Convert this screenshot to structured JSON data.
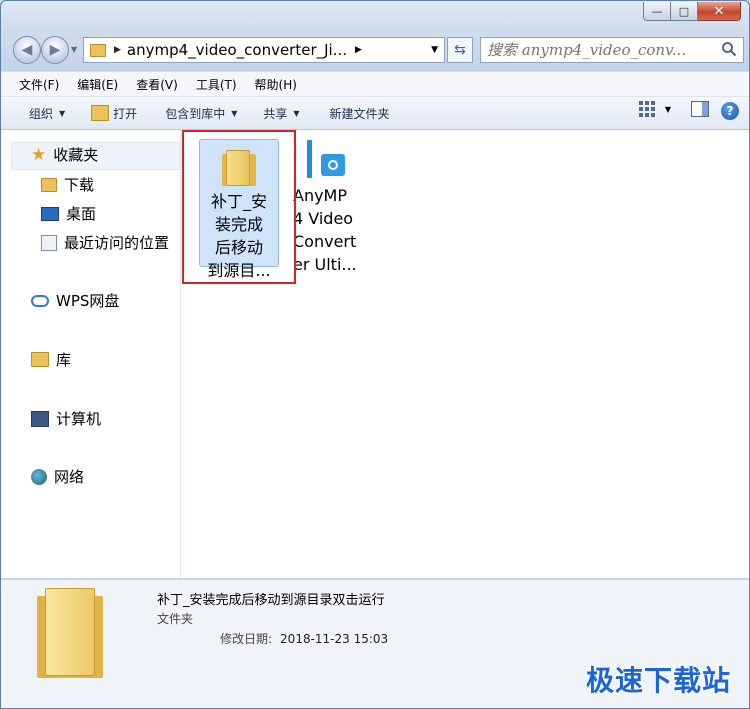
{
  "window": {
    "caption": {
      "minimize": "—",
      "maximize": "□",
      "close": "✕"
    }
  },
  "navigation": {
    "address_path": "anymp4_video_converter_Ji...",
    "search_placeholder": "搜索 anymp4_video_conv..."
  },
  "menubar": {
    "items": [
      "文件(F)",
      "编辑(E)",
      "查看(V)",
      "工具(T)",
      "帮助(H)"
    ]
  },
  "commandbar": {
    "organize": "组织",
    "open": "打开",
    "include_in_library": "包含到库中",
    "share": "共享",
    "new_folder": "新建文件夹"
  },
  "navpane": {
    "favorites": "收藏夹",
    "downloads": "下载",
    "desktop": "桌面",
    "recent": "最近访问的位置",
    "wps": "WPS网盘",
    "library": "库",
    "computer": "计算机",
    "network": "网络"
  },
  "files": [
    {
      "lines": [
        "补丁_安",
        "装完成",
        "后移动",
        "到源目..."
      ],
      "type": "folder",
      "selected": true
    },
    {
      "lines": [
        "AnyMP",
        "4 Video",
        "Convert",
        "er Ulti..."
      ],
      "type": "application",
      "selected": false
    }
  ],
  "details": {
    "name": "补丁_安装完成后移动到源目录双击运行",
    "type": "文件夹",
    "modified_label": "修改日期:",
    "modified_value": "2018-11-23 15:03"
  },
  "watermark": "极速下载站",
  "colors": {
    "selection": "#cfe3fb",
    "highlight_box": "#d2232a",
    "watermark": "#1d65d6"
  }
}
